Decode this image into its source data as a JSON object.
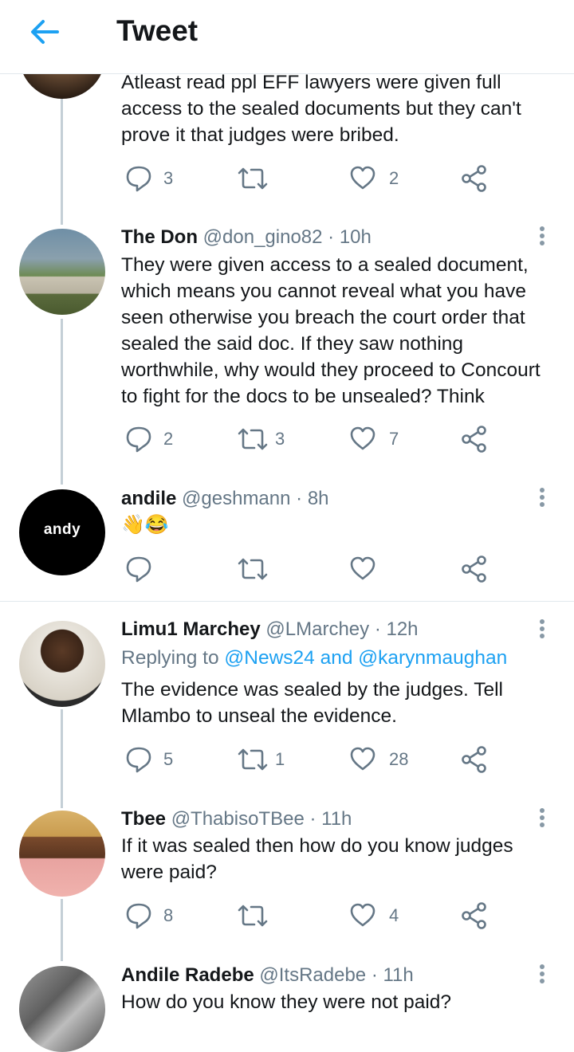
{
  "header": {
    "title": "Tweet"
  },
  "tweets": [
    {
      "body": "Atleast read ppl EFF lawyers were given full access to the sealed documents but they can't prove it that judges were bribed.",
      "replies": "3",
      "retweets": "",
      "likes": "2"
    },
    {
      "name": "The Don",
      "handle": "@don_gino82",
      "time": "· 10h",
      "body": "They were given access to a sealed document, which means you cannot reveal what you have seen otherwise you breach the court order that sealed the said doc.  If they saw nothing worthwhile, why would they proceed to Concourt to fight for the docs to be unsealed? Think",
      "replies": "2",
      "retweets": "3",
      "likes": "7"
    },
    {
      "name": "andile",
      "handle": "@geshmann",
      "time": "· 8h",
      "avatar_text": "andy",
      "body": "👋😂",
      "replies": "",
      "retweets": "",
      "likes": ""
    },
    {
      "name": "Limu1 Marchey",
      "handle": "@LMarchey",
      "time": "· 12h",
      "replying_prefix": "Replying to",
      "replying_mentions": "@News24 and @karynmaughan",
      "body": "The evidence was sealed by the judges. Tell Mlambo to unseal the evidence.",
      "replies": "5",
      "retweets": "1",
      "likes": "28"
    },
    {
      "name": "Tbee",
      "handle": "@ThabisoTBee",
      "time": "· 11h",
      "body": "If it was sealed then how do you know judges were paid?",
      "replies": "8",
      "retweets": "",
      "likes": "4"
    },
    {
      "name": "Andile Radebe",
      "handle": "@ItsRadebe",
      "time": "· 11h",
      "body": "How do you know they were not paid?",
      "replies": "",
      "retweets": "",
      "likes": ""
    }
  ],
  "icons": {
    "back": "arrow-left-icon",
    "reply": "reply-icon",
    "retweet": "retweet-icon",
    "like": "heart-icon",
    "share": "share-icon",
    "more": "more-vertical-icon"
  },
  "colors": {
    "accent": "#1da1f2",
    "secondary_text": "#657786",
    "icon_gray": "#657786"
  }
}
